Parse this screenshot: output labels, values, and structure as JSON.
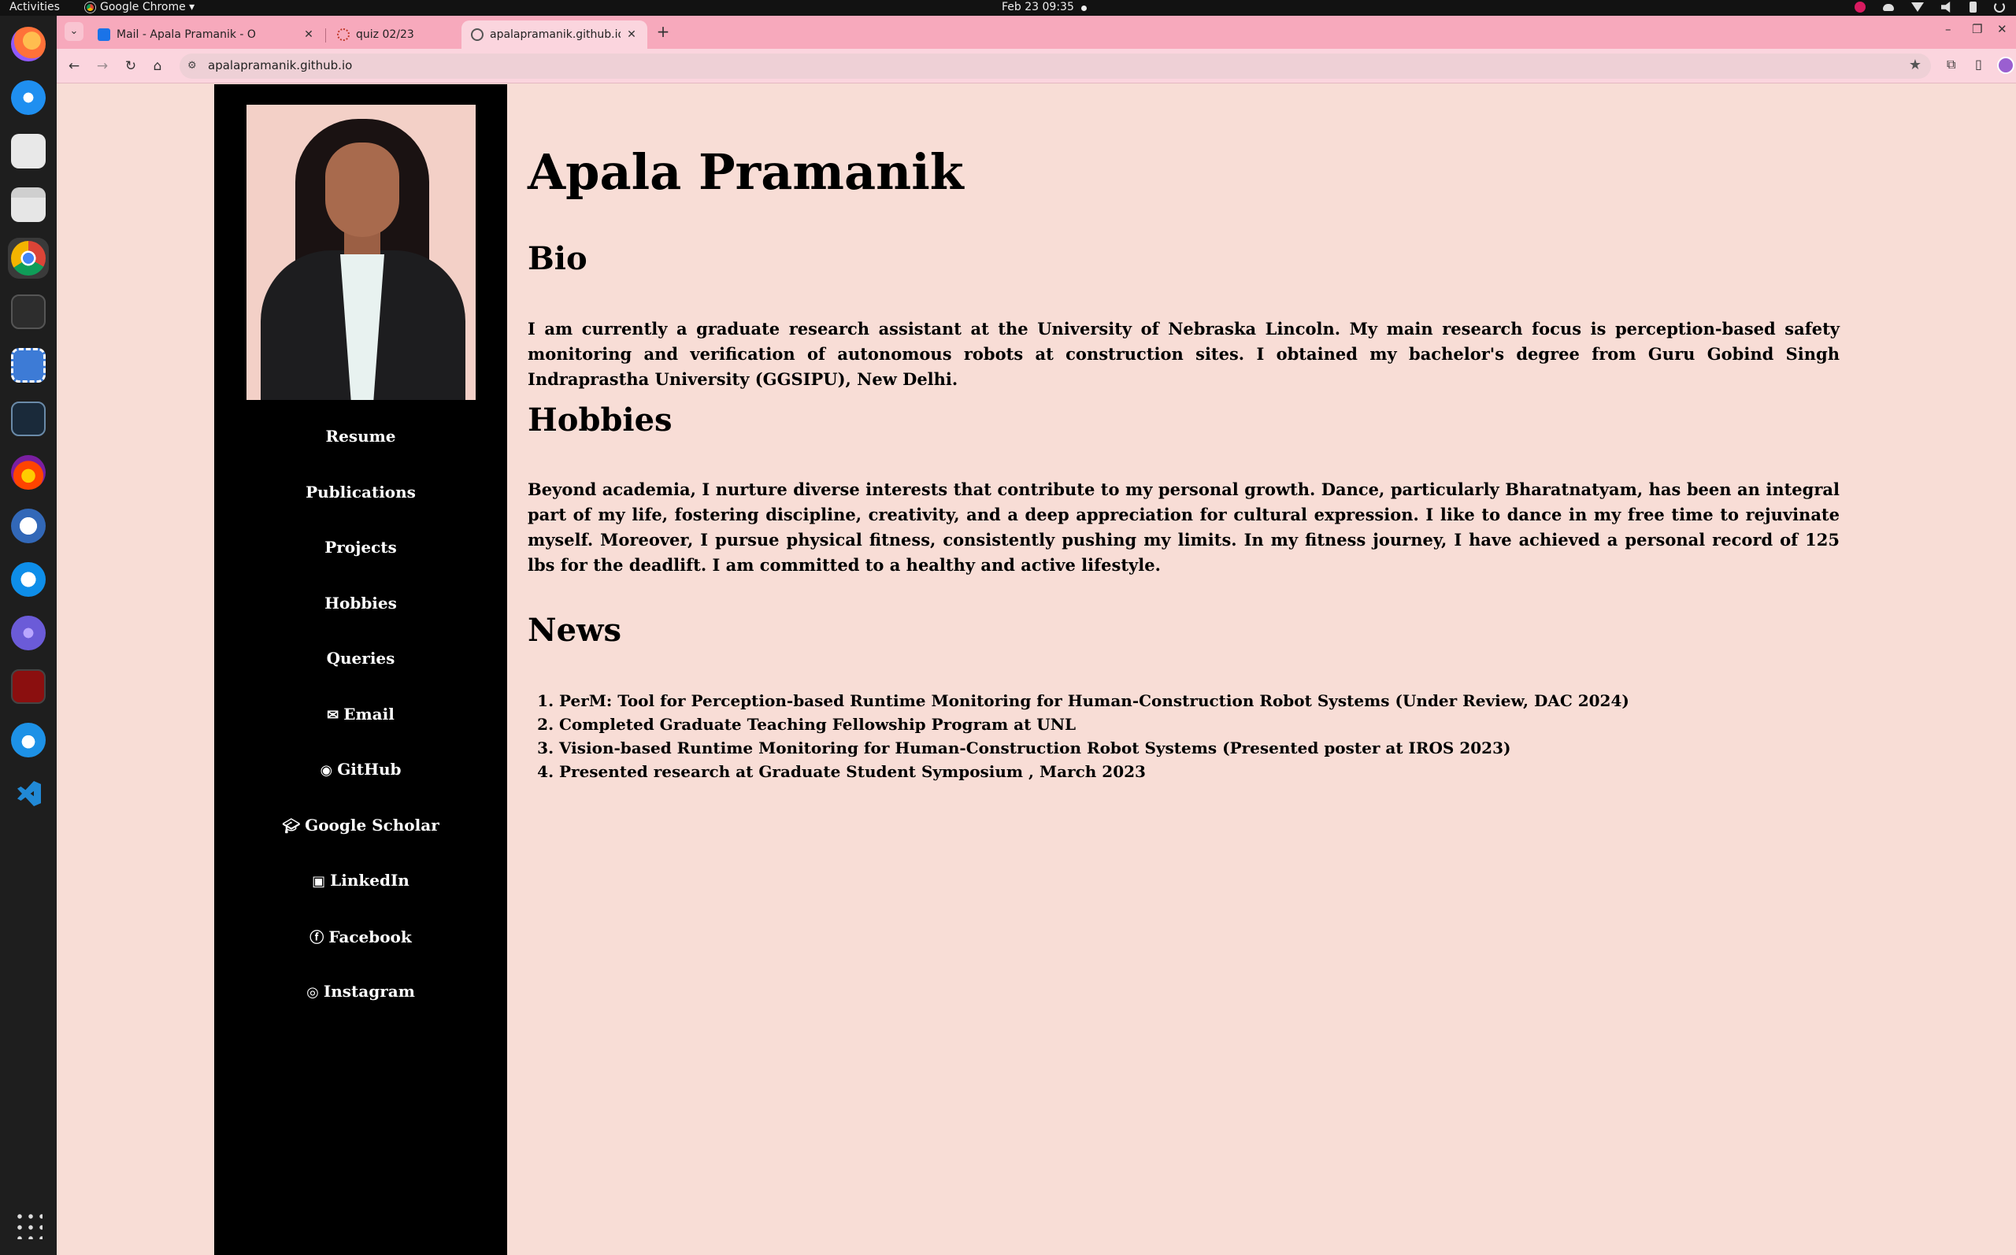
{
  "os": {
    "activities": "Activities",
    "app_menu": "Google Chrome ▾",
    "clock": "Feb 23  09:35"
  },
  "browser": {
    "tabs": [
      {
        "title": "Mail - Apala Pramanik - O"
      },
      {
        "title": "quiz 02/23"
      },
      {
        "title": "apalapramanik.github.io"
      }
    ],
    "url": "apalapramanik.github.io"
  },
  "page": {
    "name": "Apala Pramanik",
    "nav": [
      {
        "label": "Resume",
        "icon": ""
      },
      {
        "label": "Publications",
        "icon": ""
      },
      {
        "label": "Projects",
        "icon": ""
      },
      {
        "label": "Hobbies",
        "icon": ""
      },
      {
        "label": "Queries",
        "icon": ""
      },
      {
        "label": "Email",
        "icon": "envelope-icon"
      },
      {
        "label": "GitHub",
        "icon": "github-icon"
      },
      {
        "label": "Google Scholar",
        "icon": "graduation-cap-icon"
      },
      {
        "label": "LinkedIn",
        "icon": "linkedin-icon"
      },
      {
        "label": "Facebook",
        "icon": "facebook-icon"
      },
      {
        "label": "Instagram",
        "icon": "instagram-icon"
      }
    ],
    "bio": {
      "heading": "Bio",
      "text": "I am currently a graduate research assistant at the University of Nebraska Lincoln. My main research focus is perception-based safety monitoring and verification of autonomous robots at construction sites. I obtained my bachelor's degree from Guru Gobind Singh Indraprastha University (GGSIPU), New Delhi."
    },
    "hobbies": {
      "heading": "Hobbies",
      "text": "Beyond academia, I nurture diverse interests that contribute to my personal growth. Dance, particularly Bharatnatyam, has been an integral part of my life, fostering discipline, creativity, and a deep appreciation for cultural expression. I like to dance in my free time to rejuvinate myself. Moreover, I pursue physical fitness, consistently pushing my limits. In my fitness journey, I have achieved a personal record of 125 lbs for the deadlift. I am committed to a healthy and active lifestyle."
    },
    "news": {
      "heading": "News",
      "items": [
        "PerM: Tool for Perception-based Runtime Monitoring for Human-Construction Robot Systems (Under Review, DAC 2024)",
        "Completed Graduate Teaching Fellowship Program at UNL",
        "Vision-based Runtime Monitoring for Human-Construction Robot Systems (Presented poster at IROS 2023)",
        "Presented research at Graduate Student Symposium , March 2023"
      ]
    }
  },
  "colors": {
    "page_bg": "#f8ddd6",
    "sidebar_bg": "#000000",
    "tab_strip": "#f7a9bc"
  }
}
